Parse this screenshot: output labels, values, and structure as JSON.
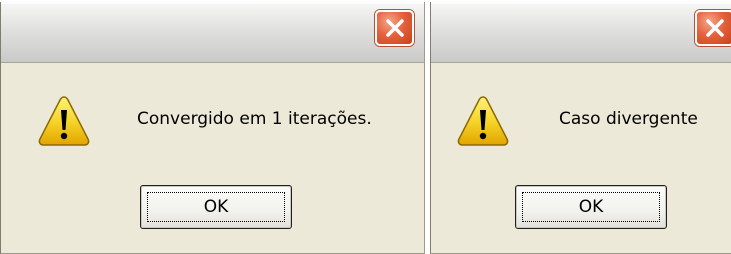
{
  "dialogs": [
    {
      "message": "Convergido em 1 iterações.",
      "ok_label": "OK",
      "icon": "warning-icon",
      "close_icon": "close-icon"
    },
    {
      "message": "Caso divergente",
      "ok_label": "OK",
      "icon": "warning-icon",
      "close_icon": "close-icon"
    }
  ],
  "colors": {
    "dialog_background": "#ece9d8",
    "close_button": "#e5623d",
    "warning_yellow": "#f6d52a"
  }
}
